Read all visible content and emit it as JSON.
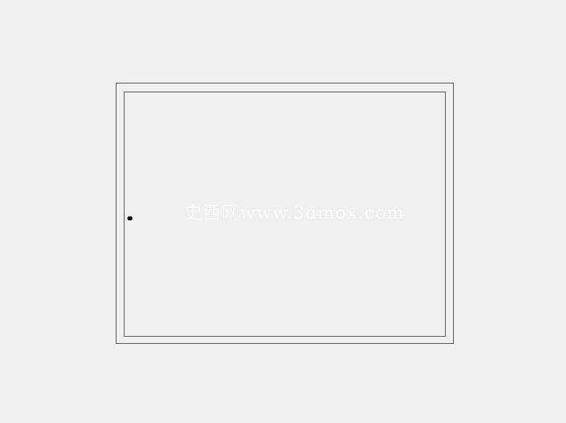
{
  "watermark": {
    "text": "史西网www.3dmox.com"
  },
  "colors": {
    "background": "#f0f0f0",
    "frame_border": "#6a6a6a",
    "watermark": "#ffffff"
  },
  "icons": {
    "cursor": "hand-cursor-icon"
  }
}
